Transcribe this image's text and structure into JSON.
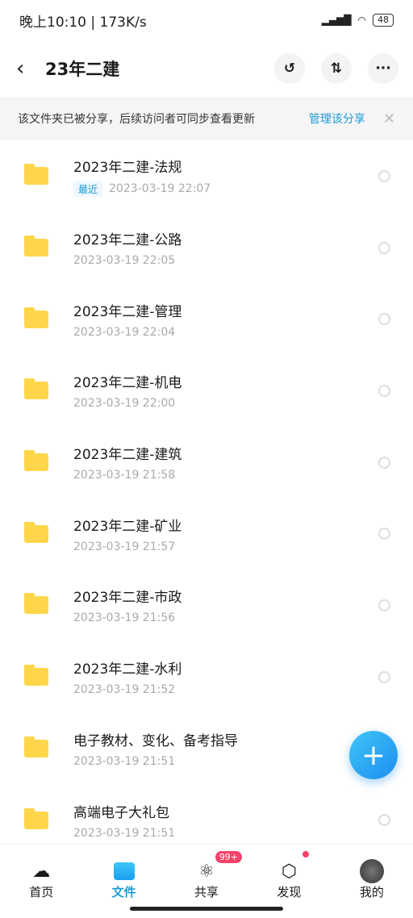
{
  "status": {
    "time": "晚上10:10 | 173K/s",
    "battery": "48"
  },
  "nav": {
    "title": "23年二建"
  },
  "banner": {
    "text": "该文件夹已被分享，后续访问者可同步查看更新",
    "link": "管理该分享"
  },
  "files": [
    {
      "name": "2023年二建-法规",
      "tag": "最近",
      "date": "2023-03-19  22:07"
    },
    {
      "name": "2023年二建-公路",
      "date": "2023-03-19  22:05"
    },
    {
      "name": "2023年二建-管理",
      "date": "2023-03-19  22:04"
    },
    {
      "name": "2023年二建-机电",
      "date": "2023-03-19  22:00"
    },
    {
      "name": "2023年二建-建筑",
      "date": "2023-03-19  21:58"
    },
    {
      "name": "2023年二建-矿业",
      "date": "2023-03-19  21:57"
    },
    {
      "name": "2023年二建-市政",
      "date": "2023-03-19  21:56"
    },
    {
      "name": "2023年二建-水利",
      "date": "2023-03-19  21:52"
    },
    {
      "name": "电子教材、变化、备考指导",
      "date": "2023-03-19  21:51"
    },
    {
      "name": "高端电子大礼包",
      "date": "2023-03-19  21:51"
    }
  ],
  "tabs": [
    {
      "label": "首页"
    },
    {
      "label": "文件"
    },
    {
      "label": "共享",
      "badge": "99+"
    },
    {
      "label": "发现"
    },
    {
      "label": "我的"
    }
  ]
}
